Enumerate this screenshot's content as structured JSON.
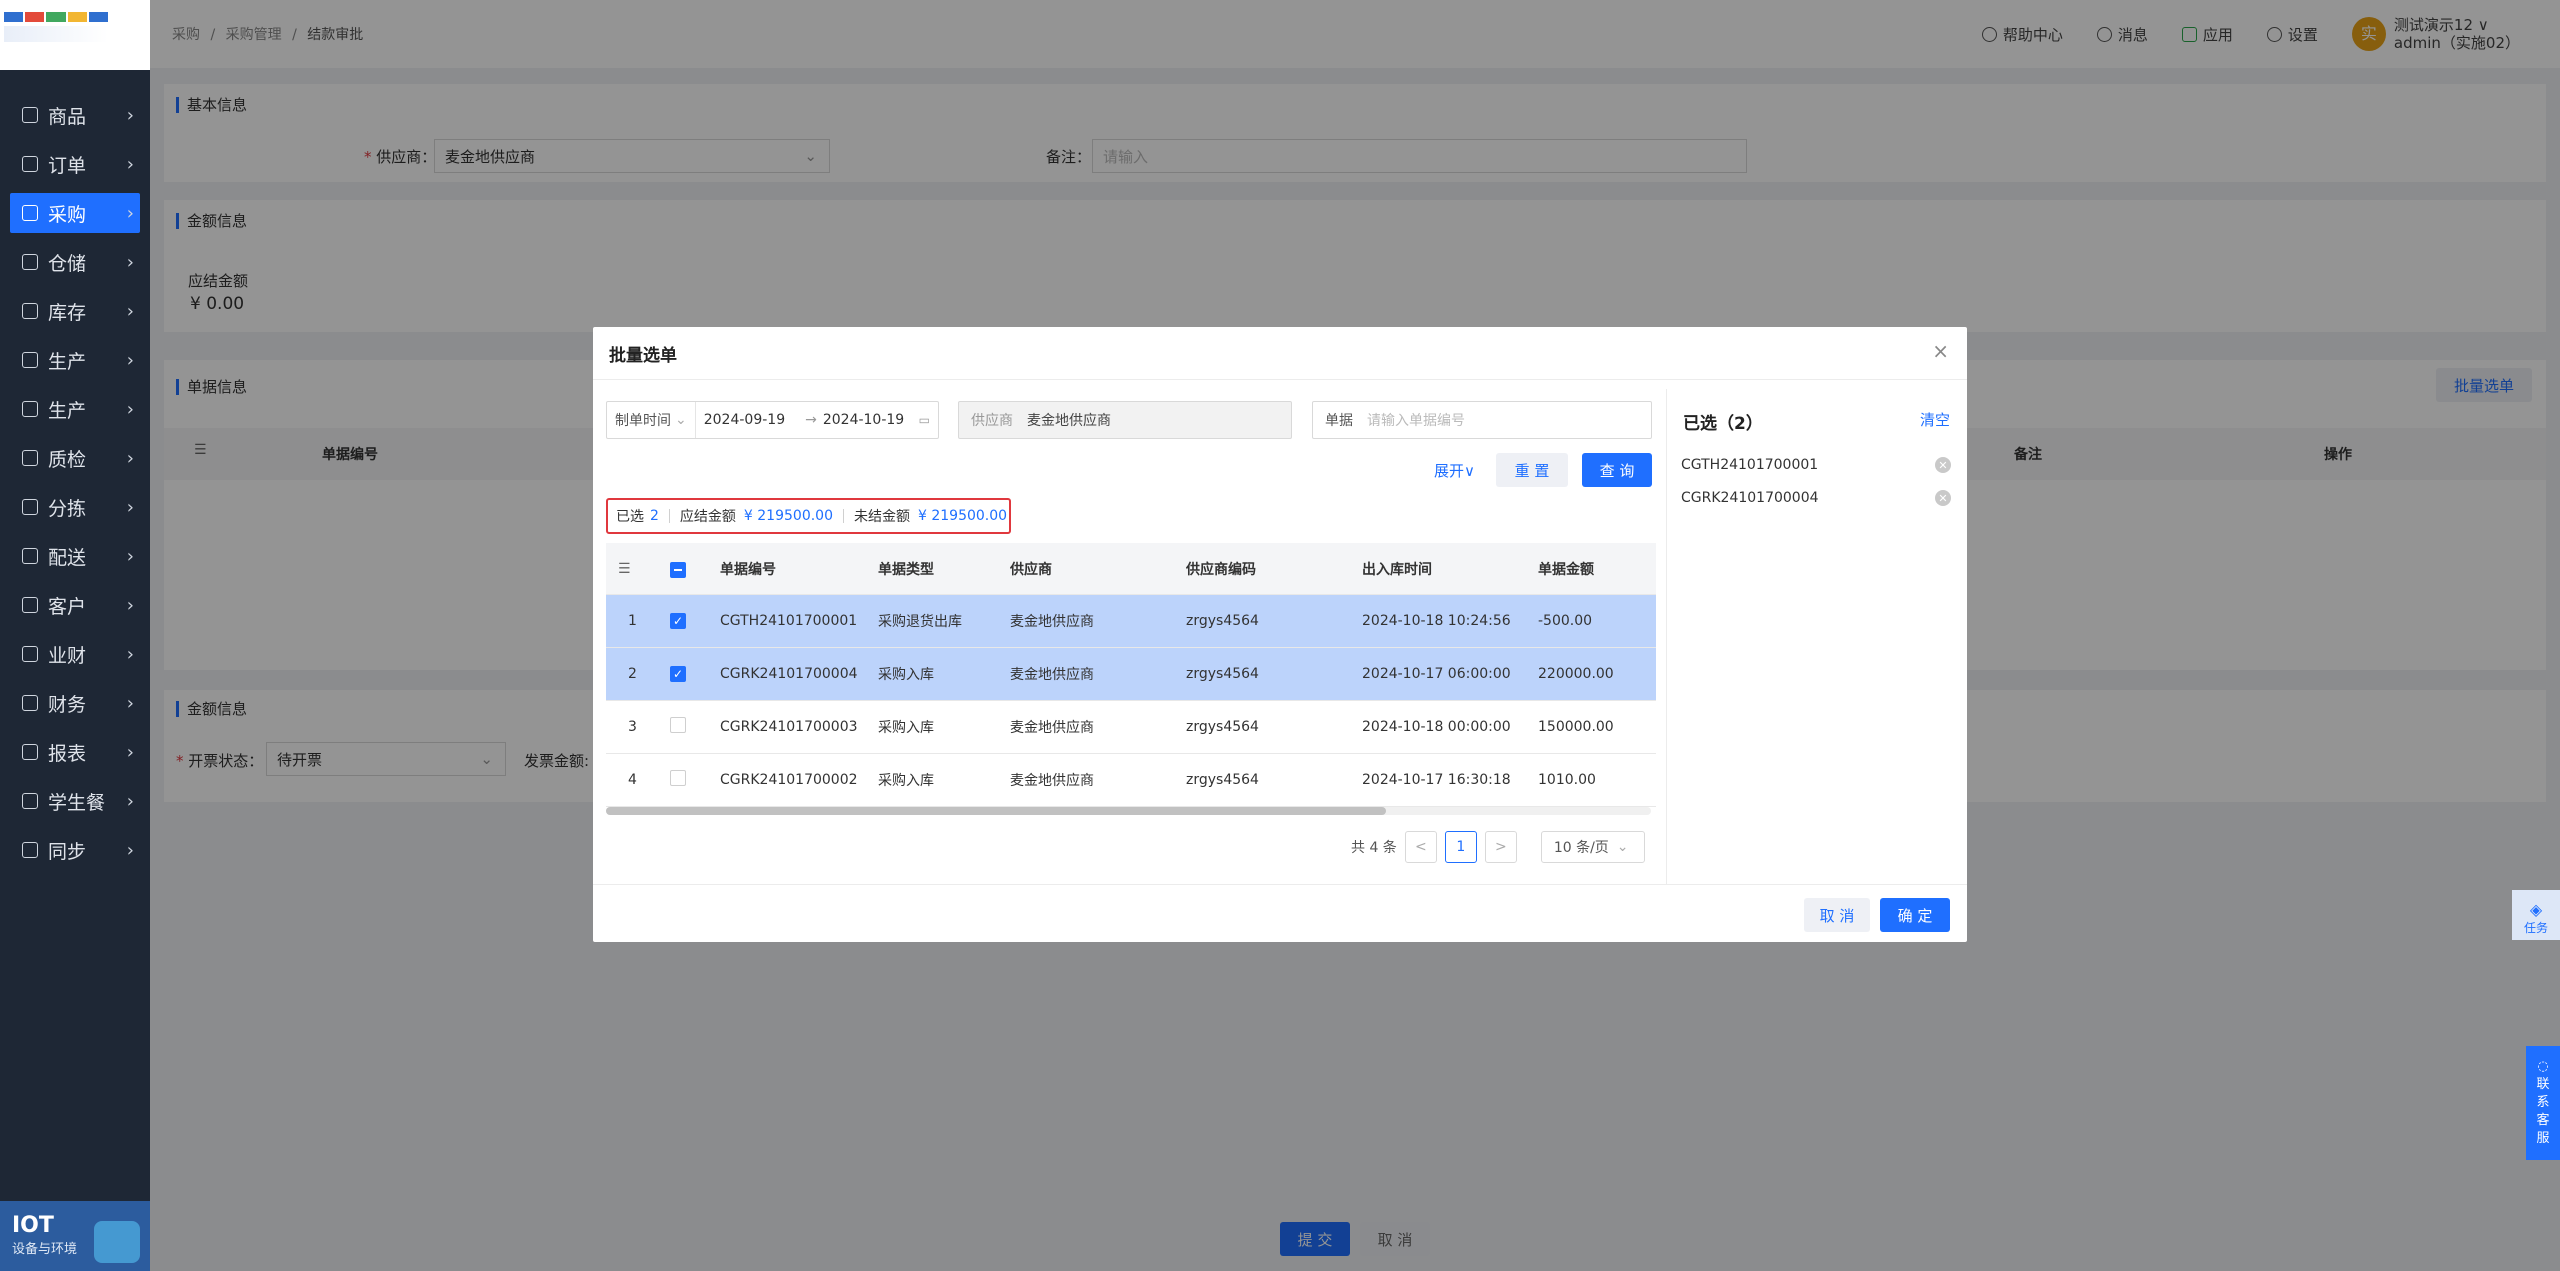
{
  "colors": {
    "accent": "#1f6fff",
    "sidebar_bg": "#1e2735",
    "highlight_border": "#e0383e",
    "selected_row": "#bcd3fb"
  },
  "sidebar": {
    "items": [
      {
        "label": "商品",
        "icon": "grid-icon",
        "active": false
      },
      {
        "label": "订单",
        "icon": "clipboard-icon",
        "active": false
      },
      {
        "label": "采购",
        "icon": "basket-icon",
        "active": true
      },
      {
        "label": "仓储",
        "icon": "warehouse-icon",
        "active": false
      },
      {
        "label": "库存",
        "icon": "inventory-icon",
        "active": false
      },
      {
        "label": "生产",
        "icon": "factory-icon",
        "active": false
      },
      {
        "label": "生产",
        "icon": "factory-icon",
        "active": false
      },
      {
        "label": "质检",
        "icon": "shield-icon",
        "active": false
      },
      {
        "label": "分拣",
        "icon": "sort-icon",
        "active": false
      },
      {
        "label": "配送",
        "icon": "truck-icon",
        "active": false
      },
      {
        "label": "客户",
        "icon": "user-icon",
        "active": false
      },
      {
        "label": "业财",
        "icon": "chart-icon",
        "active": false
      },
      {
        "label": "财务",
        "icon": "ledger-icon",
        "active": false
      },
      {
        "label": "报表",
        "icon": "clock-icon",
        "active": false
      },
      {
        "label": "学生餐",
        "icon": "bowl-icon",
        "active": false
      },
      {
        "label": "同步",
        "icon": "sync-icon",
        "active": false
      }
    ],
    "iot_title": "IOT",
    "iot_sub": "设备与环境"
  },
  "header": {
    "breadcrumb": [
      "采购",
      "/",
      "采购管理",
      "/",
      "结款审批"
    ],
    "help": "帮助中心",
    "messages": "消息",
    "apps": "应用",
    "settings": "设置",
    "avatar_char": "实",
    "user_name": "测试演示12",
    "user_role": "admin（实施02）",
    "user_caret": "∨"
  },
  "page": {
    "basic_title": "基本信息",
    "supplier_label": "供应商：",
    "supplier_required": "*",
    "supplier_value": "麦金地供应商",
    "remark_label": "备注：",
    "remark_placeholder": "请输入",
    "amount_title": "金额信息",
    "payable_label": "应结金额",
    "payable_value": "¥ 0.00",
    "doc_title": "单据信息",
    "batch_button": "批量选单",
    "doc_col_no": "单据编号",
    "doc_col_remark": "备注",
    "doc_col_op": "操作",
    "amount2_title": "金额信息",
    "invoice_label": "开票状态：",
    "invoice_required": "*",
    "invoice_value": "待开票",
    "invoice_amount_label": "发票金额:",
    "submit": "提 交",
    "cancel": "取 消"
  },
  "modal": {
    "title": "批量选单",
    "close": "×",
    "date_type": "制单时间",
    "date_start": "2024-09-19",
    "date_arrow": "→",
    "date_end": "2024-10-19",
    "supplier_label": "供应商",
    "supplier_value": "麦金地供应商",
    "doc_label": "单据",
    "doc_placeholder": "请输入单据编号",
    "expand": "展开∨",
    "reset": "重 置",
    "query": "查 询",
    "summary": {
      "selected_label": "已选",
      "selected_count": "2",
      "payable_label": "应结金额",
      "payable_value": "¥ 219500.00",
      "unsettled_label": "未结金额",
      "unsettled_value": "¥ 219500.00"
    },
    "columns": [
      "单据编号",
      "单据类型",
      "供应商",
      "供应商编码",
      "出入库时间",
      "单据金额"
    ],
    "rows": [
      {
        "idx": "1",
        "checked": true,
        "no": "CGTH24101700001",
        "type": "采购退货出库",
        "supplier": "麦金地供应商",
        "code": "zrgys4564",
        "time": "2024-10-18 10:24:56",
        "amount": "-500.00"
      },
      {
        "idx": "2",
        "checked": true,
        "no": "CGRK24101700004",
        "type": "采购入库",
        "supplier": "麦金地供应商",
        "code": "zrgys4564",
        "time": "2024-10-17 06:00:00",
        "amount": "220000.00"
      },
      {
        "idx": "3",
        "checked": false,
        "no": "CGRK24101700003",
        "type": "采购入库",
        "supplier": "麦金地供应商",
        "code": "zrgys4564",
        "time": "2024-10-18 00:00:00",
        "amount": "150000.00"
      },
      {
        "idx": "4",
        "checked": false,
        "no": "CGRK24101700002",
        "type": "采购入库",
        "supplier": "麦金地供应商",
        "code": "zrgys4564",
        "time": "2024-10-17 16:30:18",
        "amount": "1010.00"
      }
    ],
    "pagination": {
      "total": "共 4 条",
      "prev": "<",
      "page": "1",
      "next": ">",
      "page_size": "10 条/页"
    },
    "selected_panel": {
      "title": "已选（2）",
      "clear": "清空",
      "items": [
        "CGTH24101700001",
        "CGRK24101700004"
      ]
    },
    "cancel": "取 消",
    "confirm": "确 定"
  },
  "widgets": {
    "task": "任务",
    "contact": [
      "联",
      "系",
      "客",
      "服"
    ]
  }
}
